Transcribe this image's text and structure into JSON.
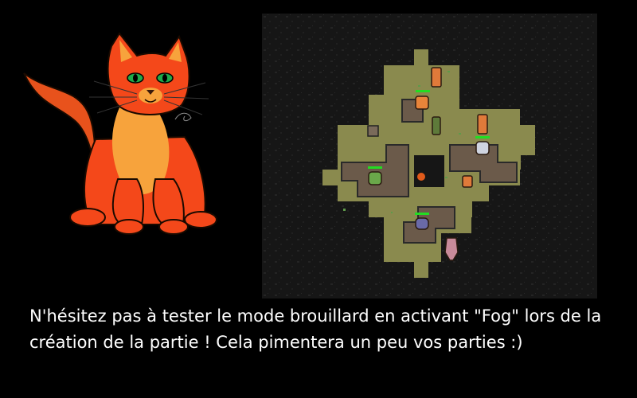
{
  "slide": {
    "caption": "N'hésitez pas à tester le mode brouillard en activant \"Fog\" lors de la création de la partie ! Cela pimentera un peu vos parties :)"
  },
  "scene": {
    "mascot": "red-orange-cat-drawing",
    "map": "dungeon-map-with-fog",
    "colors": {
      "fog": "#161616",
      "floor": "#8a8a4e",
      "wall": "#6b5a4a",
      "health_bar": "#22dd22"
    }
  }
}
